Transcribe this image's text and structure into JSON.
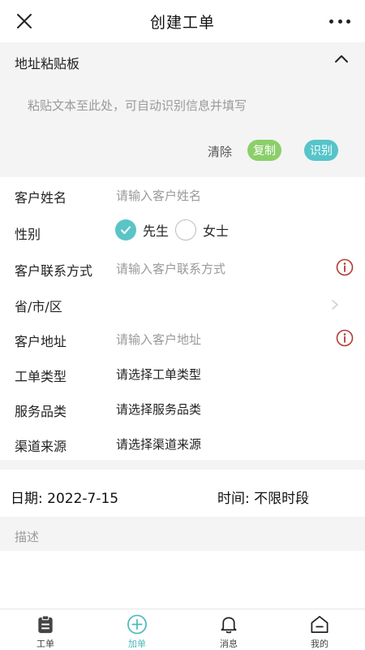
{
  "header": {
    "title": "创建工单",
    "close_icon": "close-icon",
    "more_icon": "more-icon"
  },
  "clipboard": {
    "title": "地址粘贴板",
    "placeholder": "粘贴文本至此处，可自动识别信息并填写",
    "clear_label": "清除",
    "copy_label": "复制",
    "recognize_label": "识别",
    "copy_color": "#8bcf6a",
    "recognize_color": "#56c4c9"
  },
  "form": {
    "customer_name": {
      "label": "客户姓名",
      "placeholder": "请输入客户姓名"
    },
    "gender": {
      "label": "性别",
      "options": [
        "先生",
        "女士"
      ],
      "selected": "先生"
    },
    "contact": {
      "label": "客户联系方式",
      "placeholder": "请输入客户联系方式"
    },
    "region": {
      "label": "省/市/区"
    },
    "address": {
      "label": "客户地址",
      "placeholder": "请输入客户地址"
    },
    "order_type": {
      "label": "工单类型",
      "value": "请选择工单类型"
    },
    "service_category": {
      "label": "服务品类",
      "value": "请选择服务品类"
    },
    "channel": {
      "label": "渠道来源",
      "value": "请选择渠道来源"
    }
  },
  "schedule": {
    "date": "日期: 2022-7-15",
    "time": "时间: 不限时段"
  },
  "description": {
    "placeholder": "描述"
  },
  "tabbar": {
    "active_color": "#4cb9bd",
    "items": [
      {
        "label": "工单",
        "icon": "clipboard-icon"
      },
      {
        "label": "加单",
        "icon": "plus-circle-icon"
      },
      {
        "label": "消息",
        "icon": "bell-icon"
      },
      {
        "label": "我的",
        "icon": "home-icon"
      }
    ]
  }
}
